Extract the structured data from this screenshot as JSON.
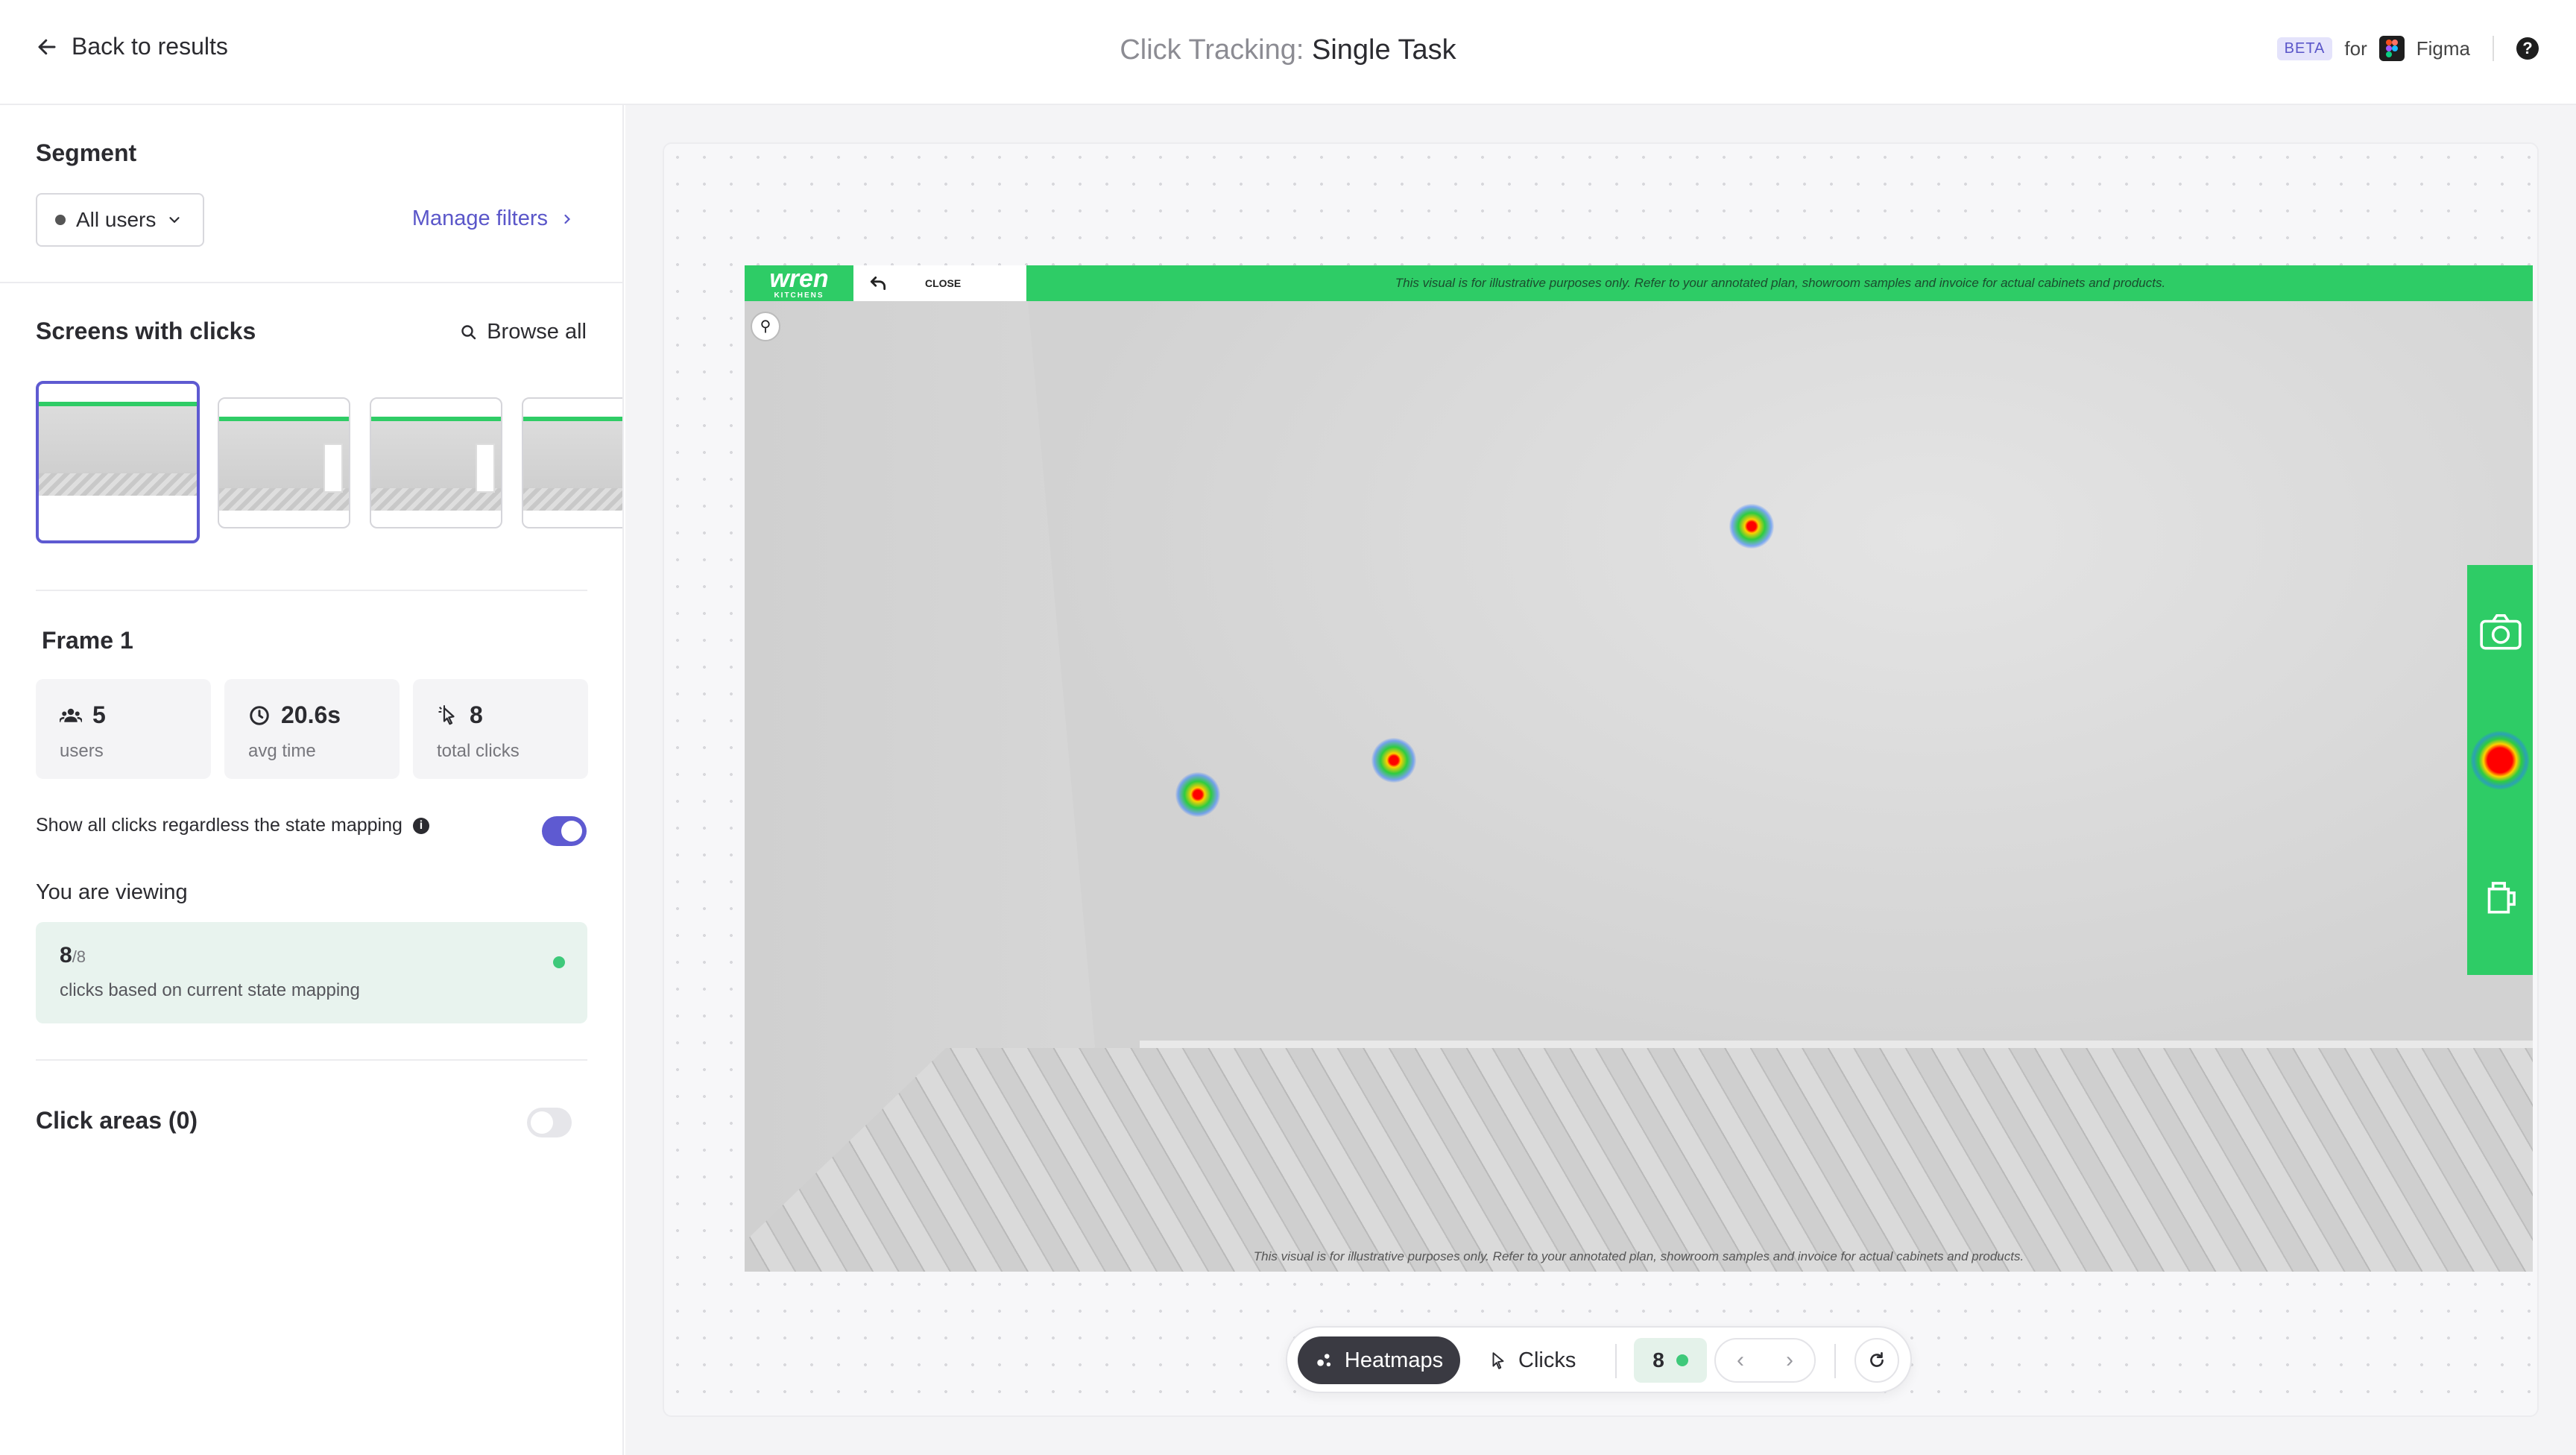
{
  "header": {
    "back_label": "Back to results",
    "title_prefix": "Click Tracking:",
    "title_main": "Single Task",
    "beta_badge": "BETA",
    "for_text": "for",
    "figma_label": "Figma",
    "help_icon": "?"
  },
  "sidebar": {
    "segment_title": "Segment",
    "segment_value": "All users",
    "manage_filters": "Manage filters",
    "screens_title": "Screens with clicks",
    "browse_all": "Browse all",
    "frame_title": "Frame 1",
    "stats": [
      {
        "value": "5",
        "label": "users",
        "icon": "users-icon"
      },
      {
        "value": "20.6s",
        "label": "avg time",
        "icon": "clock-icon"
      },
      {
        "value": "8",
        "label": "total clicks",
        "icon": "cursor-icon"
      }
    ],
    "show_all_label": "Show all clicks regardless the state mapping",
    "show_all_on": true,
    "viewing_title": "You are viewing",
    "viewing_count": "8",
    "viewing_total": "/8",
    "viewing_desc": "clicks based on current state mapping",
    "click_areas_label": "Click areas (0)",
    "click_areas_on": false
  },
  "screen": {
    "logo_text": "wren",
    "logo_sub": "KITCHENS",
    "close_label": "CLOSE",
    "top_note": "This visual is for illustrative purposes only. Refer to your annotated plan, showroom samples and invoice for actual cabinets and products.",
    "bottom_note": "This visual is for illustrative purposes only. Refer to your annotated plan, showroom samples and invoice for actual cabinets and products."
  },
  "toolbar": {
    "heatmaps_label": "Heatmaps",
    "clicks_label": "Clicks",
    "count": "8"
  },
  "colors": {
    "accent": "#5e5ad1",
    "brand_green": "#2ecc66",
    "status_green": "#3ec97a"
  }
}
